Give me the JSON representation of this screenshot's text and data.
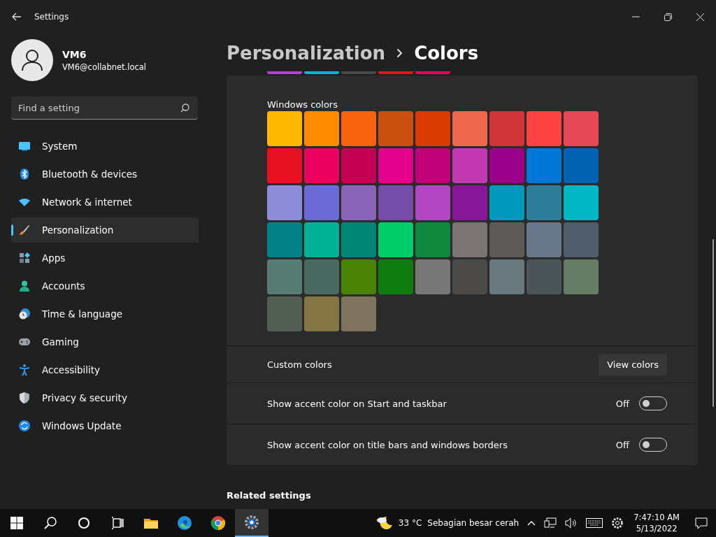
{
  "window": {
    "title": "Settings"
  },
  "user": {
    "name": "VM6",
    "email": "VM6@collabnet.local"
  },
  "search": {
    "placeholder": "Find a setting"
  },
  "nav": [
    {
      "label": "System",
      "kind": "system",
      "selected": false
    },
    {
      "label": "Bluetooth & devices",
      "kind": "bluetooth",
      "selected": false
    },
    {
      "label": "Network & internet",
      "kind": "network",
      "selected": false
    },
    {
      "label": "Personalization",
      "kind": "brush",
      "selected": true
    },
    {
      "label": "Apps",
      "kind": "apps",
      "selected": false
    },
    {
      "label": "Accounts",
      "kind": "accounts",
      "selected": false
    },
    {
      "label": "Time & language",
      "kind": "time",
      "selected": false
    },
    {
      "label": "Gaming",
      "kind": "gaming",
      "selected": false
    },
    {
      "label": "Accessibility",
      "kind": "accessibility",
      "selected": false
    },
    {
      "label": "Privacy & security",
      "kind": "privacy",
      "selected": false
    },
    {
      "label": "Windows Update",
      "kind": "update",
      "selected": false
    }
  ],
  "breadcrumb": {
    "parent": "Personalization",
    "current": "Colors"
  },
  "recent_colors": [
    {
      "color": "#b146c2"
    },
    {
      "color": "#00b7c3"
    },
    {
      "color": "#4c4a48"
    },
    {
      "color": "#e81123"
    },
    {
      "color": "#ea005e"
    }
  ],
  "windows_colors": {
    "title": "Windows colors",
    "swatches": [
      {
        "color": "#ffb900"
      },
      {
        "color": "#ff8c00"
      },
      {
        "color": "#f7630c"
      },
      {
        "color": "#ca5010"
      },
      {
        "color": "#da3b01"
      },
      {
        "color": "#ef6950"
      },
      {
        "color": "#d13438"
      },
      {
        "color": "#ff4343"
      },
      {
        "color": "#e74856"
      },
      {
        "color": "#e81123"
      },
      {
        "color": "#ea005e"
      },
      {
        "color": "#c30052"
      },
      {
        "color": "#e3008c"
      },
      {
        "color": "#bf0077"
      },
      {
        "color": "#c239b3"
      },
      {
        "color": "#9a0089"
      },
      {
        "color": "#0078d7"
      },
      {
        "color": "#0063b1"
      },
      {
        "color": "#8e8cd8"
      },
      {
        "color": "#6b69d6"
      },
      {
        "color": "#8764b8"
      },
      {
        "color": "#744da9"
      },
      {
        "color": "#b146c2"
      },
      {
        "color": "#881798"
      },
      {
        "color": "#0099bc"
      },
      {
        "color": "#2d7d9a"
      },
      {
        "color": "#00b7c3"
      },
      {
        "color": "#038387"
      },
      {
        "color": "#00b294"
      },
      {
        "color": "#018574"
      },
      {
        "color": "#00cc6a"
      },
      {
        "color": "#10893e"
      },
      {
        "color": "#7a7574"
      },
      {
        "color": "#5d5a58"
      },
      {
        "color": "#68768a"
      },
      {
        "color": "#515c6b"
      },
      {
        "color": "#567c73"
      },
      {
        "color": "#486860"
      },
      {
        "color": "#498205"
      },
      {
        "color": "#107c10"
      },
      {
        "color": "#767676"
      },
      {
        "color": "#4c4a48"
      },
      {
        "color": "#69797e"
      },
      {
        "color": "#4a5459"
      },
      {
        "color": "#647c64"
      },
      {
        "color": "#525e54"
      },
      {
        "color": "#847545"
      },
      {
        "color": "#7e735f"
      }
    ]
  },
  "custom_colors": {
    "label": "Custom colors",
    "button": "View colors"
  },
  "toggles": [
    {
      "label": "Show accent color on Start and taskbar",
      "state_text": "Off",
      "on": false
    },
    {
      "label": "Show accent color on title bars and windows borders",
      "state_text": "Off",
      "on": false
    }
  ],
  "related": {
    "title": "Related settings"
  },
  "taskbar": {
    "apps": [
      {
        "kind": "start",
        "active": false
      },
      {
        "kind": "search",
        "active": false
      },
      {
        "kind": "cortana",
        "active": false
      },
      {
        "kind": "taskview",
        "active": false
      },
      {
        "kind": "folder",
        "active": false
      },
      {
        "kind": "edge",
        "active": false
      },
      {
        "kind": "chrome",
        "active": false
      },
      {
        "kind": "settings",
        "active": true
      }
    ],
    "weather": {
      "temp": "33 °C",
      "text": "Sebagian besar cerah"
    },
    "time": "7:47:10 AM",
    "date": "5/13/2022"
  }
}
